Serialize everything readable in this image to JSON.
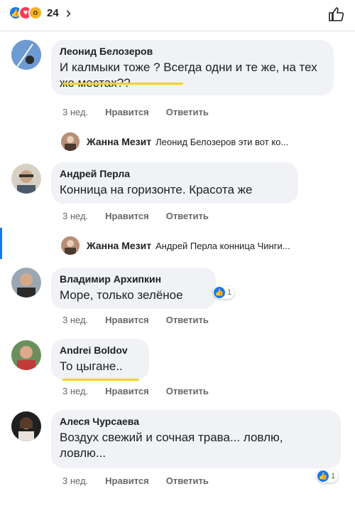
{
  "header": {
    "reaction_count": "24",
    "chevron": "›",
    "reactions": [
      "like-icon",
      "love-icon",
      "wow-icon"
    ]
  },
  "comments": [
    {
      "author": "Леонид Белозеров",
      "text": "И калмыки тоже ? Всегда одни и те же, на тех же местах??",
      "time": "3 нед.",
      "like": "Нравится",
      "reply": "Ответить"
    },
    {
      "author": "Андрей Перла",
      "text": "Конница на горизонте. Красота же",
      "time": "3 нед.",
      "like": "Нравится",
      "reply": "Ответить"
    },
    {
      "author": "Владимир Архипкин",
      "text": "Море, только зелёное",
      "time": "3 нед.",
      "like": "Нравится",
      "reply": "Ответить",
      "likes": "1"
    },
    {
      "author": "Andrei Boldov",
      "text": "То цыгане..",
      "time": "3 нед.",
      "like": "Нравится",
      "reply": "Ответить"
    },
    {
      "author": "Алеся Чурсаева",
      "text": "Воздух свежий и сочная трава... ловлю, ловлю...",
      "time": "3 нед.",
      "like": "Нравится",
      "reply": "Ответить",
      "likes": "1"
    }
  ],
  "replies": [
    {
      "author": "Жанна Мезит",
      "text": "Леонид Белозеров эти вот ко..."
    },
    {
      "author": "Жанна Мезит",
      "text": "Андрей Перла конница Чинги..."
    }
  ],
  "colors": {
    "accent": "#1877f2",
    "highlight": "#f5d31a",
    "bubble": "#f0f2f5"
  }
}
